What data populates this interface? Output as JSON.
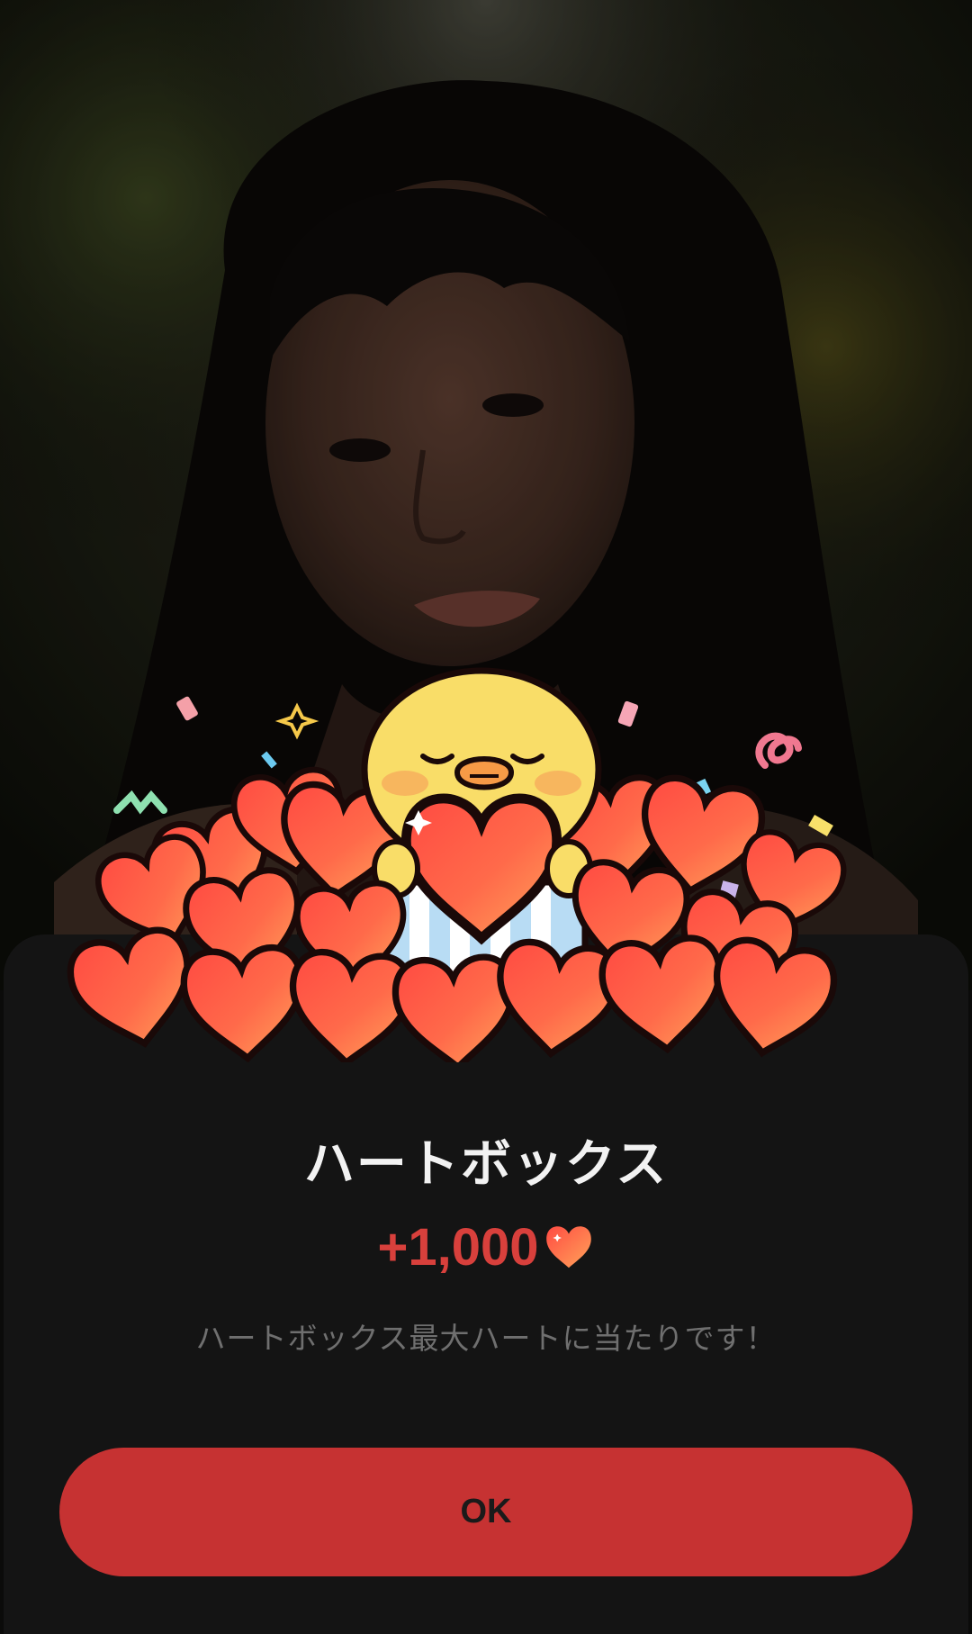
{
  "dialog": {
    "title": "ハートボックス",
    "reward_amount": "+1,000",
    "reward_icon": "heart-icon",
    "message": "ハートボックス最大ハートに当たりです！",
    "ok_label": "OK"
  },
  "background": {
    "image": "portrait photo of a woman with dark wavy hair",
    "illustration": "yellow chick character holding a heart, surrounded by red hearts and confetti"
  },
  "colors": {
    "accent": "#c63232",
    "reward_text": "#d8403c",
    "sheet_bg": "#141414",
    "title_text": "#f2f2f2",
    "message_text": "#6f6f6f"
  }
}
